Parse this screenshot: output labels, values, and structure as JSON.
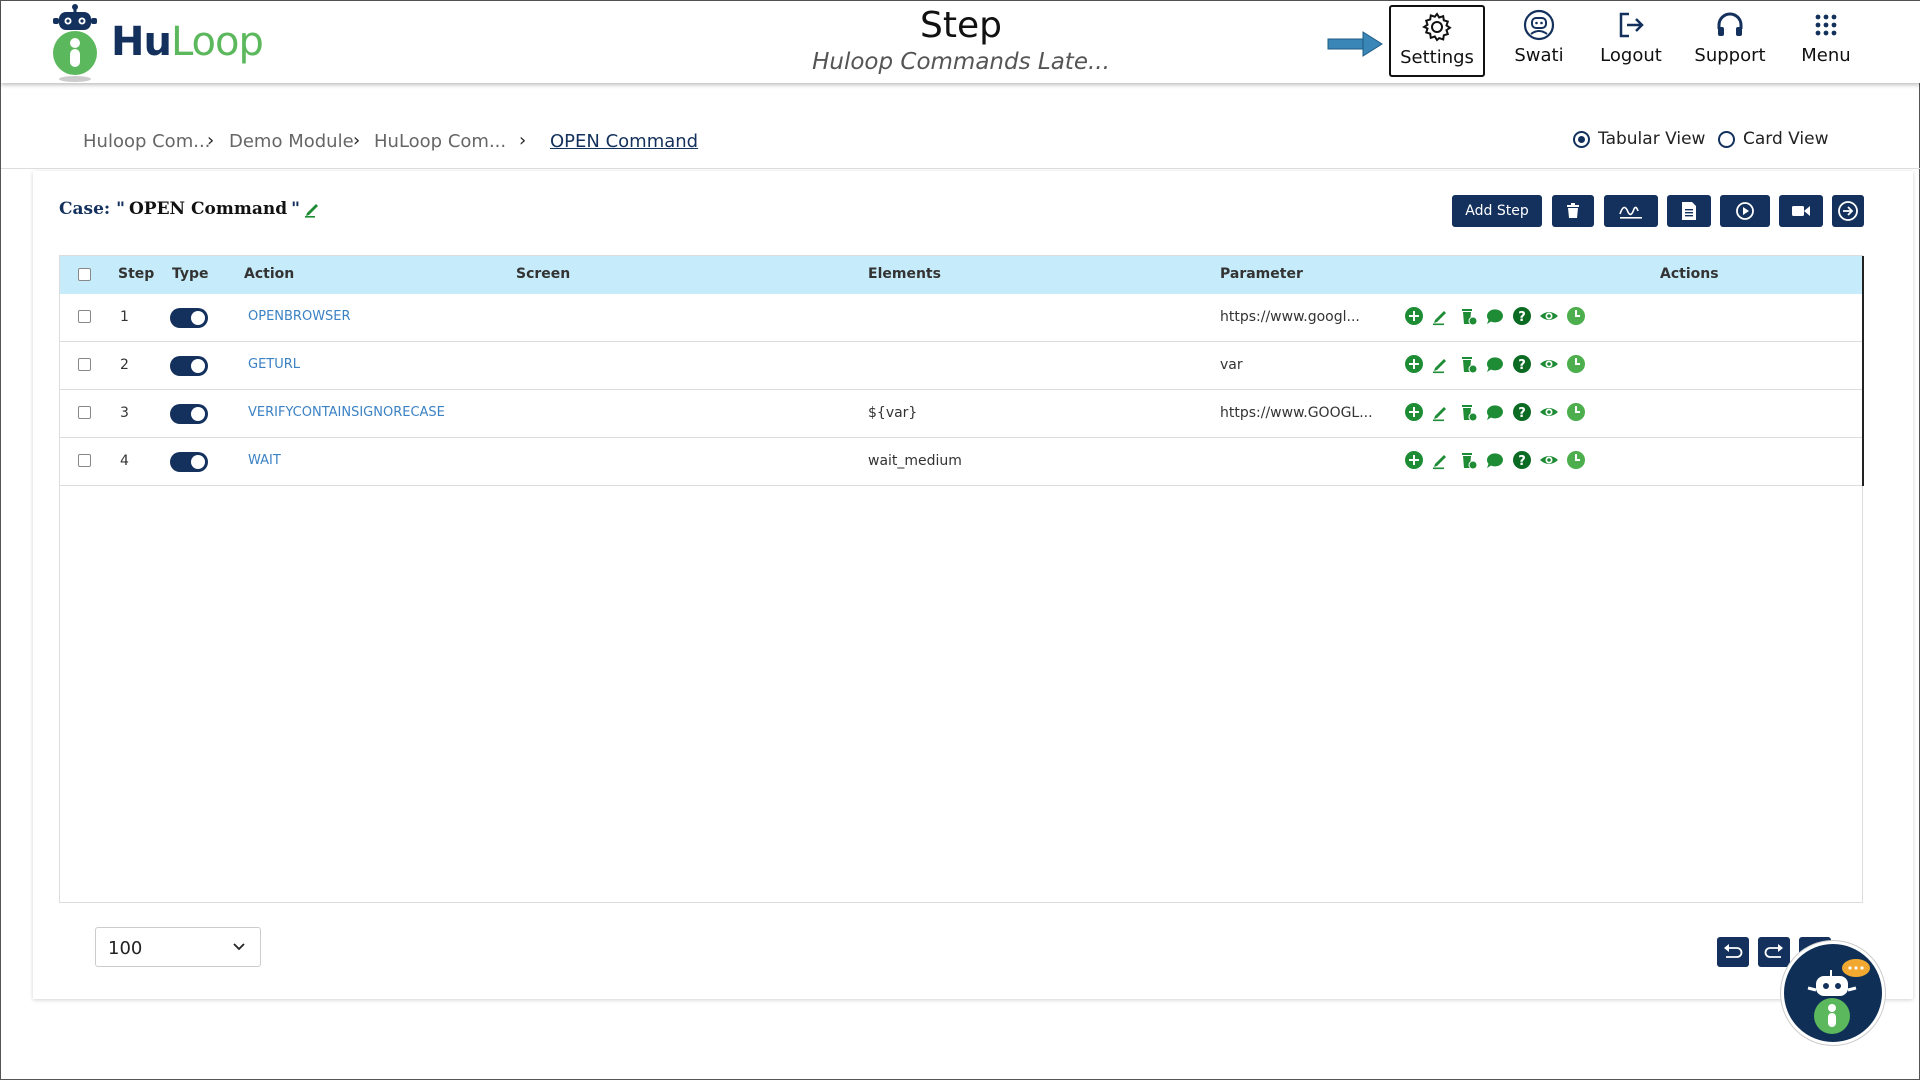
{
  "header": {
    "logo_hu": "Hu",
    "logo_loop": "Loop",
    "title": "Step",
    "subtitle": "Huloop Commands Late...",
    "nav": {
      "settings": "Settings",
      "user": "Swati",
      "logout": "Logout",
      "support": "Support",
      "menu": "Menu"
    }
  },
  "breadcrumb": {
    "items": [
      "Huloop Com...",
      "Demo Module",
      "HuLoop Com...",
      "OPEN Command"
    ]
  },
  "view": {
    "tabular": "Tabular View",
    "card": "Card View",
    "selected": "tabular"
  },
  "case": {
    "prefix": "Case: \" ",
    "name": "OPEN Command",
    "suffix": " \""
  },
  "toolbar": {
    "add_step": "Add Step"
  },
  "table": {
    "headers": {
      "step": "Step",
      "type": "Type",
      "action": "Action",
      "screen": "Screen",
      "elements": "Elements",
      "parameter": "Parameter",
      "actions": "Actions"
    },
    "rows": [
      {
        "step": "1",
        "action": "OPENBROWSER",
        "screen": "",
        "elements": "",
        "parameter": "https://www.googl..."
      },
      {
        "step": "2",
        "action": "GETURL",
        "screen": "",
        "elements": "",
        "parameter": "var"
      },
      {
        "step": "3",
        "action": "VERIFYCONTAINSIGNORECASE",
        "screen": "",
        "elements": "${var}",
        "parameter": "https://www.GOOGL..."
      },
      {
        "step": "4",
        "action": "WAIT",
        "screen": "",
        "elements": "wait_medium",
        "parameter": ""
      }
    ]
  },
  "footer": {
    "page_size": "100"
  },
  "colors": {
    "navy": "#13315c",
    "green": "#1e8c34",
    "header_row": "#c6ecfb",
    "link": "#3b82c4"
  }
}
